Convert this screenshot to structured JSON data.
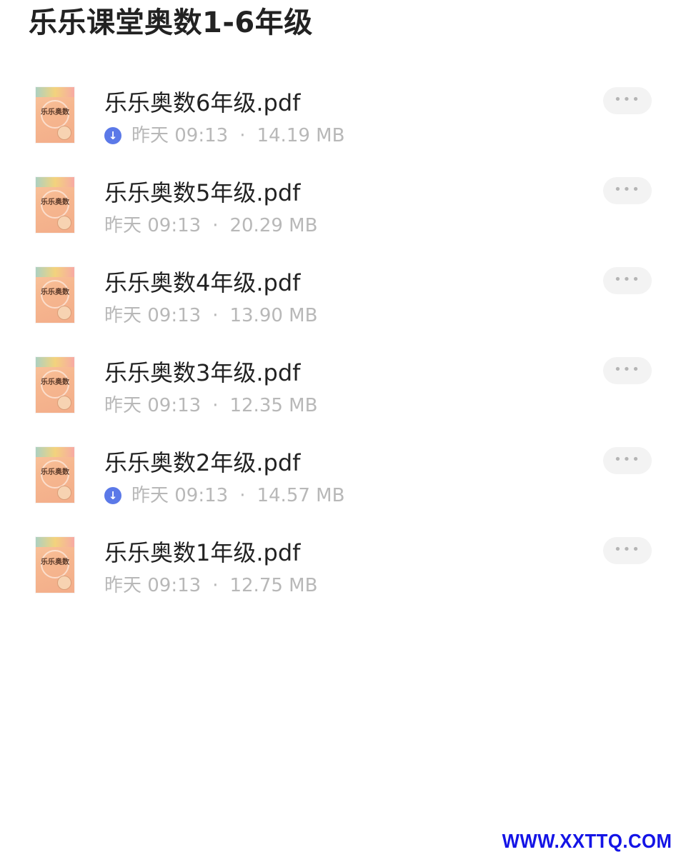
{
  "page": {
    "title": "乐乐课堂奥数1-6年级"
  },
  "files": [
    {
      "name": "乐乐奥数6年级.pdf",
      "date": "昨天 09:13",
      "size": "14.19 MB",
      "downloaded": true,
      "thumb_label": "乐乐奥数"
    },
    {
      "name": "乐乐奥数5年级.pdf",
      "date": "昨天 09:13",
      "size": "20.29 MB",
      "downloaded": false,
      "thumb_label": "乐乐奥数"
    },
    {
      "name": "乐乐奥数4年级.pdf",
      "date": "昨天 09:13",
      "size": "13.90 MB",
      "downloaded": false,
      "thumb_label": "乐乐奥数"
    },
    {
      "name": "乐乐奥数3年级.pdf",
      "date": "昨天 09:13",
      "size": "12.35 MB",
      "downloaded": false,
      "thumb_label": "乐乐奥数"
    },
    {
      "name": "乐乐奥数2年级.pdf",
      "date": "昨天 09:13",
      "size": "14.57 MB",
      "downloaded": true,
      "thumb_label": "乐乐奥数"
    },
    {
      "name": "乐乐奥数1年级.pdf",
      "date": "昨天 09:13",
      "size": "12.75 MB",
      "downloaded": false,
      "thumb_label": "乐乐奥数"
    }
  ],
  "icons": {
    "more": "more-icon",
    "download": "download-done-icon",
    "separator": "·"
  },
  "colors": {
    "download_badge": "#5b79e8",
    "watermark": "#1414e6",
    "meta_text": "#b8b8b8"
  },
  "watermark": "WWW.XXTTQ.COM"
}
